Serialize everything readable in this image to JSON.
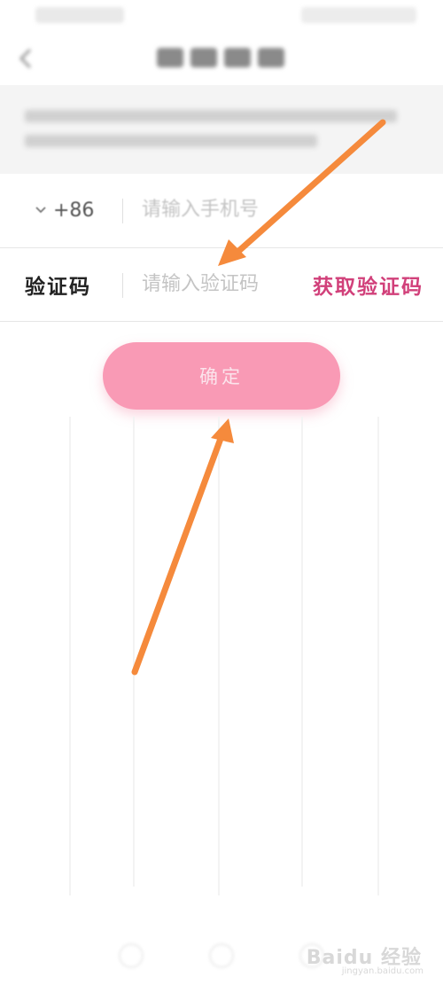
{
  "form": {
    "country_code": "+86",
    "phone_placeholder": "请输入手机号",
    "code_label": "验证码",
    "code_placeholder": "请输入验证码",
    "get_code_label": "获取验证码",
    "confirm_label": "确定"
  },
  "watermark": {
    "brand": "Baidu 经验",
    "url": "jingyan.baidu.com"
  },
  "icons": [
    "back-arrow-icon",
    "chevron-down-icon",
    "annotation-arrow-icon"
  ],
  "colors": {
    "accent": "#d1407a",
    "button": "#f99ab5",
    "annotation_arrow": "#f58a3c"
  }
}
